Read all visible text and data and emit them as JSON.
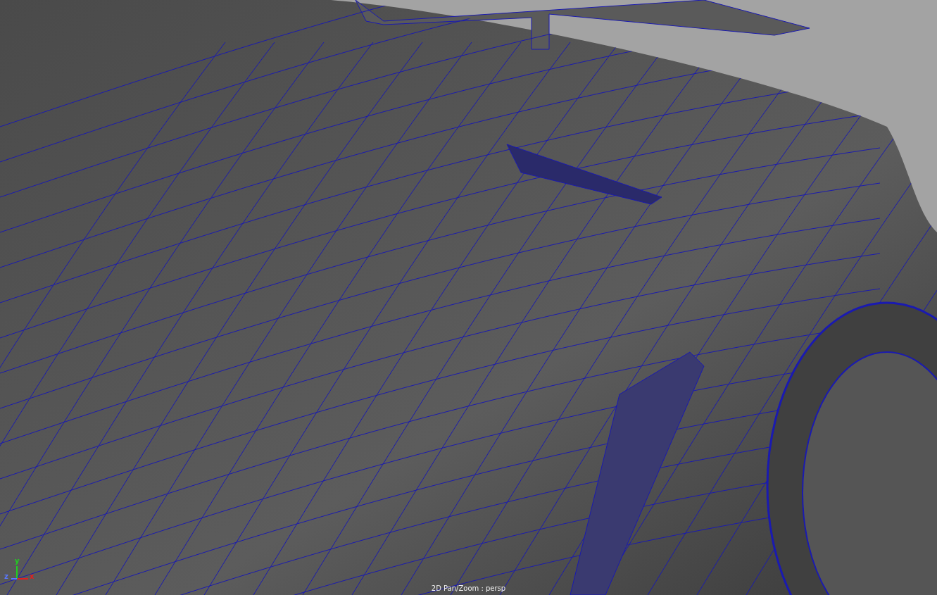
{
  "viewport": {
    "axes": [
      {
        "label": "x",
        "color": "#e02020"
      },
      {
        "label": "y",
        "color": "#20d020"
      },
      {
        "label": "z",
        "color": "#5a78ff"
      }
    ],
    "status": "2D Pan/Zoom : persp"
  }
}
